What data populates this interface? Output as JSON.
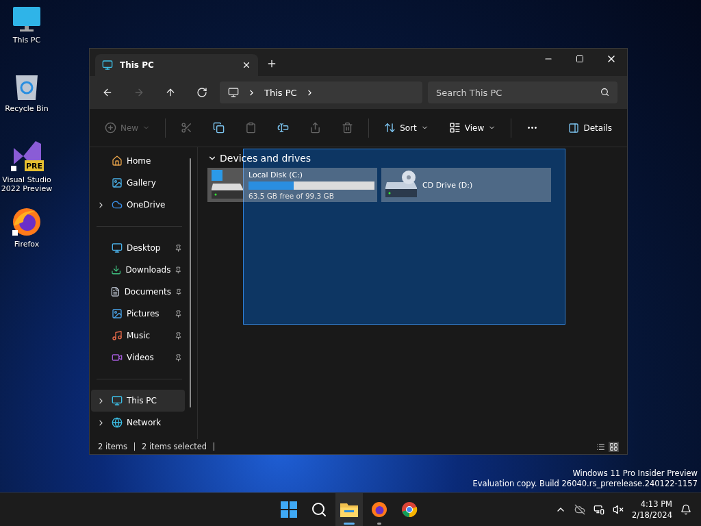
{
  "desktop_icons": [
    {
      "kind": "monitor",
      "label": "This PC"
    },
    {
      "kind": "recycle",
      "label": "Recycle Bin"
    },
    {
      "kind": "vs",
      "label": "Visual Studio 2022 Preview",
      "badge": "PRE"
    },
    {
      "kind": "firefox",
      "label": "Firefox"
    }
  ],
  "window": {
    "tabs": [
      {
        "label": "This PC",
        "selected": true
      }
    ],
    "address": {
      "crumbs": [
        "This PC"
      ]
    },
    "search": {
      "placeholder": "Search This PC"
    },
    "nav_buttons": [
      {
        "kind": "back",
        "disabled": false
      },
      {
        "kind": "forward",
        "disabled": true
      },
      {
        "kind": "up",
        "disabled": false
      },
      {
        "kind": "refresh",
        "disabled": false
      }
    ],
    "toolbar": [
      {
        "kind": "new",
        "label": "New",
        "disabled": true
      },
      {
        "kind": "cut",
        "disabled": true
      },
      {
        "kind": "copy",
        "disabled": false
      },
      {
        "kind": "paste",
        "disabled": true
      },
      {
        "kind": "rename",
        "disabled": false
      },
      {
        "kind": "share",
        "disabled": true
      },
      {
        "kind": "delete",
        "disabled": true
      },
      {
        "kind": "sort",
        "label": "Sort",
        "disabled": false
      },
      {
        "kind": "view",
        "label": "View",
        "disabled": false
      },
      {
        "kind": "more",
        "disabled": false
      }
    ],
    "details_button": "Details",
    "sidebar": {
      "groups": [
        [
          {
            "kind": "home",
            "label": "Home",
            "expandable": false,
            "pinned": false,
            "selected": false
          },
          {
            "kind": "gallery",
            "label": "Gallery",
            "expandable": false,
            "pinned": false,
            "selected": false
          },
          {
            "kind": "cloud",
            "label": "OneDrive",
            "expandable": true,
            "pinned": false,
            "selected": false
          }
        ],
        [
          {
            "kind": "desktop",
            "label": "Desktop",
            "expandable": false,
            "pinned": true,
            "selected": false
          },
          {
            "kind": "downloads",
            "label": "Downloads",
            "expandable": false,
            "pinned": true,
            "selected": false
          },
          {
            "kind": "documents",
            "label": "Documents",
            "expandable": false,
            "pinned": true,
            "selected": false
          },
          {
            "kind": "pictures",
            "label": "Pictures",
            "expandable": false,
            "pinned": true,
            "selected": false
          },
          {
            "kind": "music",
            "label": "Music",
            "expandable": false,
            "pinned": true,
            "selected": false
          },
          {
            "kind": "videos",
            "label": "Videos",
            "expandable": false,
            "pinned": true,
            "selected": false
          }
        ],
        [
          {
            "kind": "pc",
            "label": "This PC",
            "expandable": true,
            "pinned": false,
            "selected": true
          },
          {
            "kind": "network",
            "label": "Network",
            "expandable": true,
            "pinned": false,
            "selected": false
          }
        ]
      ]
    },
    "section": {
      "title": "Devices and drives",
      "expanded": true
    },
    "drives": [
      {
        "kind": "disk",
        "name": "Local Disk (C:)",
        "level": 0.36,
        "free": "63.5 GB free of 99.3 GB",
        "selected": true
      },
      {
        "kind": "cd",
        "name": "CD Drive (D:)",
        "selected": true
      }
    ],
    "status_bar": {
      "count": "2 items",
      "selection": "2 items selected",
      "view_buttons": [
        {
          "kind": "details",
          "selected": false
        },
        {
          "kind": "tiles",
          "selected": true
        }
      ]
    }
  },
  "watermark": [
    "Windows 11 Pro Insider Preview",
    "Evaluation copy. Build 26040.rs_prerelease.240122-1157"
  ],
  "taskbar": {
    "apps": [
      {
        "kind": "start",
        "active": false,
        "running": false
      },
      {
        "kind": "search",
        "active": false,
        "running": false
      },
      {
        "kind": "explorer",
        "active": true,
        "running": true
      },
      {
        "kind": "firefox",
        "active": false,
        "running": true
      },
      {
        "kind": "chrome",
        "active": false,
        "running": false
      }
    ],
    "time": "4:13 PM",
    "date": "2/18/2024"
  }
}
